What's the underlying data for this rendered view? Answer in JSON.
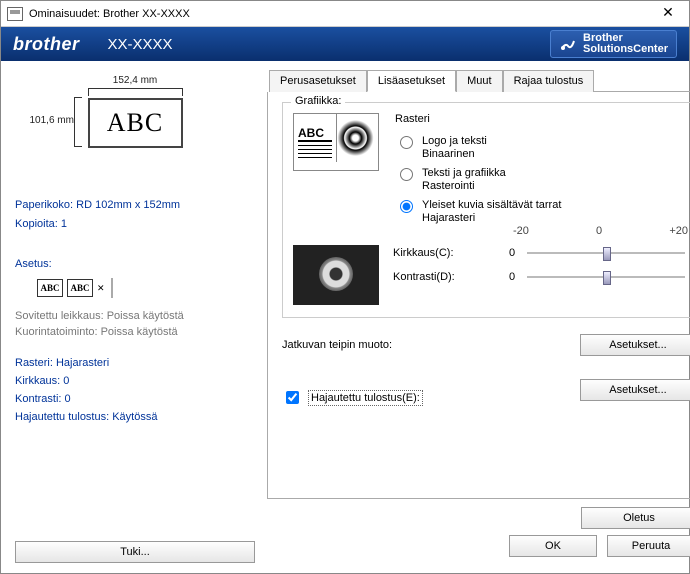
{
  "window": {
    "title": "Ominaisuudet: Brother  XX-XXXX",
    "close": "✕"
  },
  "brandbar": {
    "brand": "brother",
    "model": "XX-XXXX",
    "solutions_line1": "Brother",
    "solutions_line2": "SolutionsCenter"
  },
  "left": {
    "dim_top": "152,4 mm",
    "dim_left": "101,6 mm",
    "preview_text": "ABC",
    "paper_size_label": "Paperikoko:",
    "paper_size_value": "RD 102mm x 152mm",
    "copies_label": "Kopioita:",
    "copies_value": "1",
    "asetus_label": "Asetus:",
    "abc_mini": "ABC",
    "sovitettu": "Sovitettu leikkaus: Poissa käytöstä",
    "kuorinta": "Kuorintatoiminto: Poissa käytöstä",
    "rasteri": "Rasteri: Hajarasteri",
    "kirkkaus": "Kirkkaus:  0",
    "kontrasti": "Kontrasti:  0",
    "hajautettu": "Hajautettu tulostus: Käytössä",
    "tuki_btn": "Tuki..."
  },
  "tabs": {
    "t1": "Perusasetukset",
    "t2": "Lisäasetukset",
    "t3": "Muut",
    "t4": "Rajaa tulostus"
  },
  "graphics": {
    "legend": "Grafiikka:",
    "raster_label": "Rasteri",
    "opt1_line1": "Logo ja teksti",
    "opt1_line2": "Binaarinen",
    "opt2_line1": "Teksti ja grafiikka",
    "opt2_line2": "Rasterointi",
    "opt3_line1": "Yleiset kuvia sisältävät tarrat",
    "opt3_line2": "Hajarasteri",
    "scale_min": "-20",
    "scale_mid": "0",
    "scale_max": "+20",
    "kirkkaus_label": "Kirkkaus(C):",
    "kirkkaus_val": "0",
    "kontrasti_label": "Kontrasti(D):",
    "kontrasti_val": "0"
  },
  "tape": {
    "label": "Jatkuvan teipin muoto:",
    "btn": "Asetukset..."
  },
  "dist": {
    "chk_label": "Hajautettu tulostus(E):",
    "btn": "Asetukset..."
  },
  "oletus_btn": "Oletus",
  "ok_btn": "OK",
  "cancel_btn": "Peruuta"
}
